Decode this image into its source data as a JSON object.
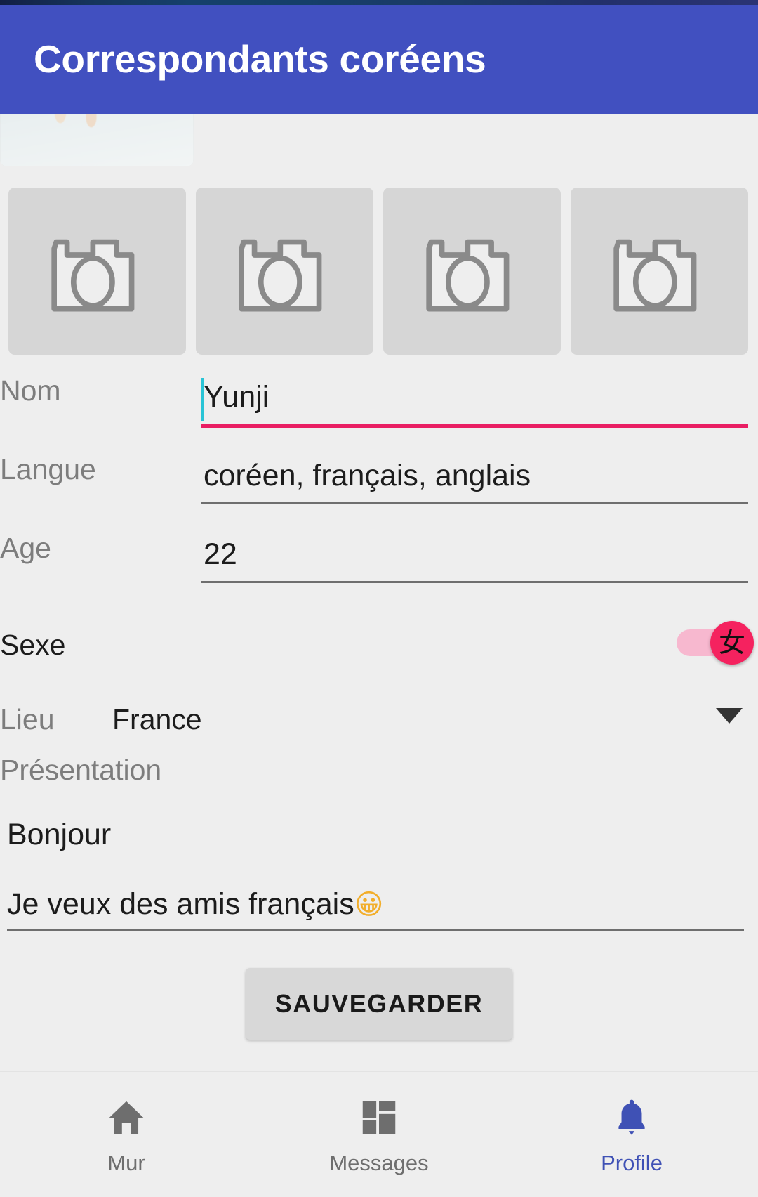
{
  "appbar": {
    "title": "Correspondants coréens",
    "background": "#4150c0",
    "text_color": "#ffffff"
  },
  "photos": {
    "cover_name": "profile-cover-photo",
    "placeholders": [
      {
        "icon": "camera-icon"
      },
      {
        "icon": "camera-icon"
      },
      {
        "icon": "camera-icon"
      },
      {
        "icon": "camera-icon"
      }
    ]
  },
  "form": {
    "nom": {
      "label": "Nom",
      "value": "Yunji",
      "placeholder": "Nom",
      "focused": true,
      "accent": "#e91e63",
      "caret_color": "#29c4d6"
    },
    "langue": {
      "label": "Langue",
      "value": "coréen, français, anglais",
      "placeholder": "Langue",
      "focused": false
    },
    "age": {
      "label": "Age",
      "value": "22",
      "placeholder": "Age",
      "focused": false
    },
    "sexe": {
      "label": "Sexe",
      "toggle_glyph": "女",
      "toggle_on": true,
      "track_color": "#f7b8cf",
      "thumb_color": "#f5225f"
    },
    "lieu": {
      "label": "Lieu",
      "value": "France",
      "arrow_icon": "chevron-down-icon"
    },
    "presentation": {
      "label": "Présentation",
      "line1": "Bonjour",
      "line2_text": "Je veux des amis français",
      "line2_emoji": "😀"
    }
  },
  "actions": {
    "save_label": "SAUVEGARDER"
  },
  "bottom_nav": {
    "active_color": "#3f51b5",
    "inactive_color": "#6e6e6e",
    "items": [
      {
        "label": "Mur",
        "icon": "home-icon",
        "active": false
      },
      {
        "label": "Messages",
        "icon": "dashboard-grid-icon",
        "active": false
      },
      {
        "label": "Profile",
        "icon": "bell-icon",
        "active": true
      }
    ]
  }
}
